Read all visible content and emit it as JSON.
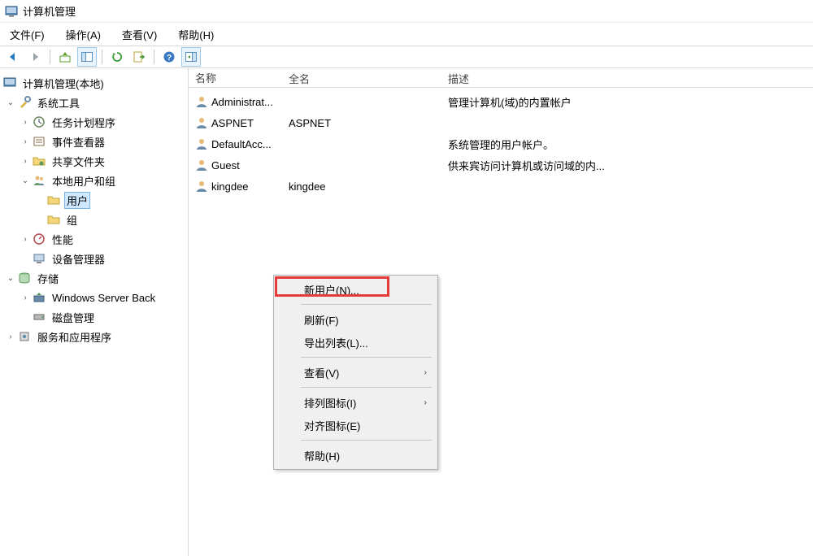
{
  "window": {
    "title": "计算机管理"
  },
  "menu": {
    "file": "文件(F)",
    "action": "操作(A)",
    "view": "查看(V)",
    "help": "帮助(H)"
  },
  "tree": {
    "root": "计算机管理(本地)",
    "system_tools": "系统工具",
    "task_scheduler": "任务计划程序",
    "event_viewer": "事件查看器",
    "shared_folders": "共享文件夹",
    "local_users": "本地用户和组",
    "users": "用户",
    "groups": "组",
    "performance": "性能",
    "device_manager": "设备管理器",
    "storage": "存储",
    "wsb": "Windows Server Back",
    "disk_mgmt": "磁盘管理",
    "services": "服务和应用程序"
  },
  "columns": {
    "name": "名称",
    "fullname": "全名",
    "desc": "描述"
  },
  "users": [
    {
      "name": "Administrat...",
      "fullname": "",
      "desc": "管理计算机(域)的内置帐户"
    },
    {
      "name": "ASPNET",
      "fullname": "ASPNET",
      "desc": ""
    },
    {
      "name": "DefaultAcc...",
      "fullname": "",
      "desc": "系统管理的用户帐户。"
    },
    {
      "name": "Guest",
      "fullname": "",
      "desc": "供来宾访问计算机或访问域的内..."
    },
    {
      "name": "kingdee",
      "fullname": "kingdee",
      "desc": ""
    }
  ],
  "ctx": {
    "new_user": "新用户(N)...",
    "refresh": "刷新(F)",
    "export_list": "导出列表(L)...",
    "view": "查看(V)",
    "arrange_icons": "排列图标(I)",
    "align_icons": "对齐图标(E)",
    "help": "帮助(H)"
  }
}
